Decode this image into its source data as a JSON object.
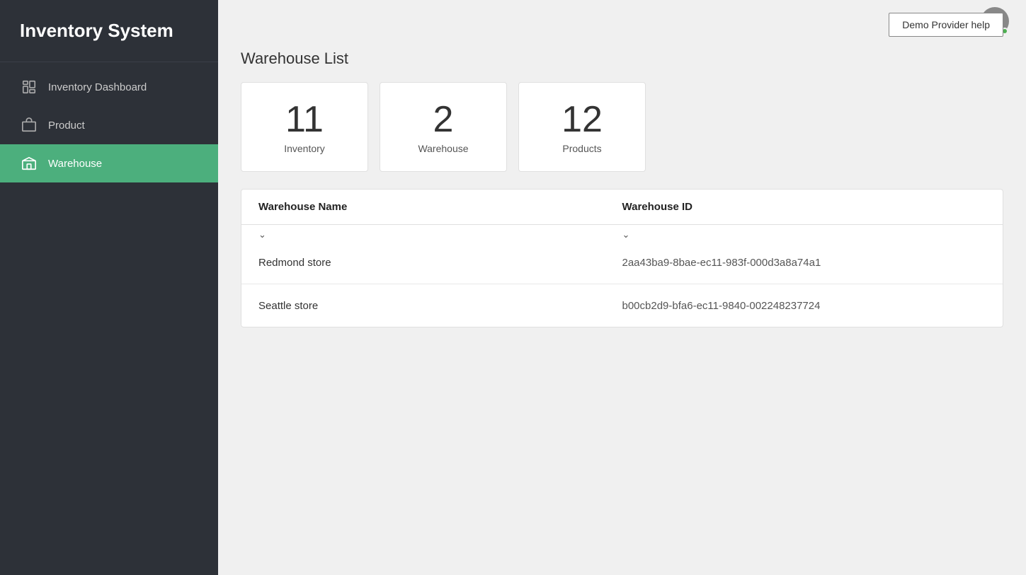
{
  "app": {
    "title": "Inventory System"
  },
  "sidebar": {
    "items": [
      {
        "id": "inventory-dashboard",
        "label": "Inventory Dashboard",
        "active": false
      },
      {
        "id": "product",
        "label": "Product",
        "active": false
      },
      {
        "id": "warehouse",
        "label": "Warehouse",
        "active": true
      }
    ]
  },
  "topbar": {
    "demo_provider_label": "Demo Provider help"
  },
  "main": {
    "page_title": "Warehouse List",
    "stats": [
      {
        "number": "11",
        "label": "Inventory"
      },
      {
        "number": "2",
        "label": "Warehouse"
      },
      {
        "number": "12",
        "label": "Products"
      }
    ],
    "table": {
      "columns": [
        {
          "key": "name",
          "label": "Warehouse Name"
        },
        {
          "key": "id",
          "label": "Warehouse ID"
        }
      ],
      "rows": [
        {
          "name": "Redmond store",
          "id": "2aa43ba9-8bae-ec11-983f-000d3a8a74a1"
        },
        {
          "name": "Seattle store",
          "id": "b00cb2d9-bfa6-ec11-9840-002248237724"
        }
      ]
    }
  }
}
